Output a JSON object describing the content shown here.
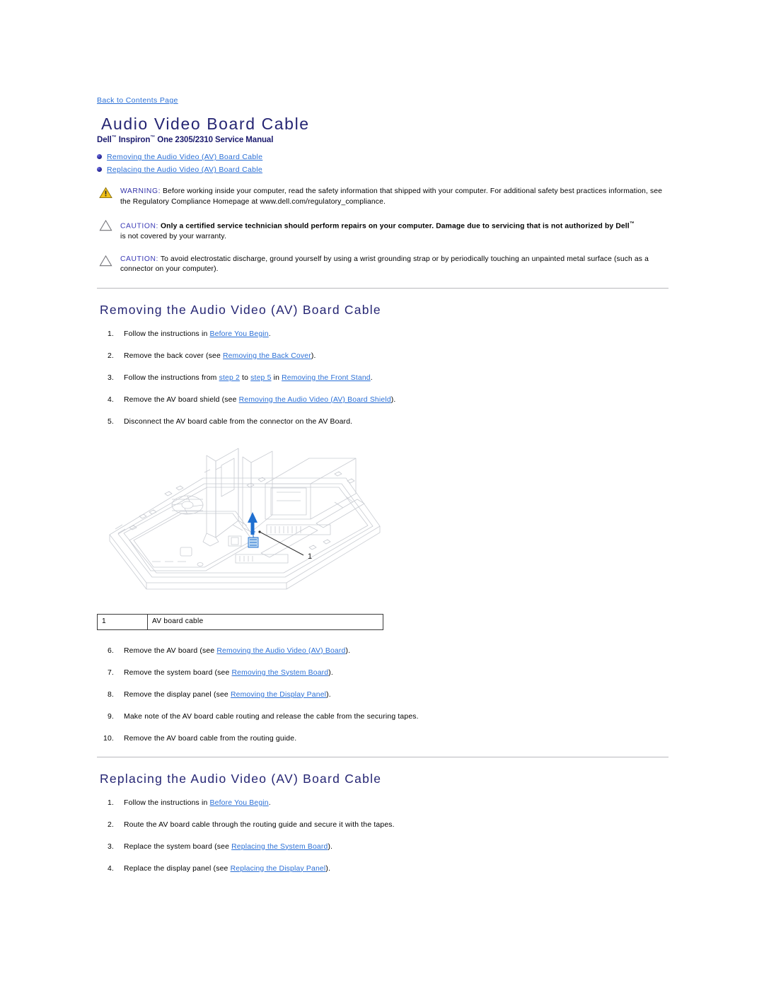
{
  "back_link": "Back to Contents Page",
  "title": "Audio Video Board Cable",
  "subtitle_parts": {
    "dell": "Dell",
    "tm1": "™",
    "inspiron": " Inspiron",
    "tm2": "™",
    "rest": " One 2305/2310 Service Manual"
  },
  "toc": [
    {
      "label": "Removing the Audio Video (AV) Board Cable"
    },
    {
      "label": "Replacing the Audio Video (AV) Board Cable"
    }
  ],
  "notices": [
    {
      "icon": "warning-triangle-icon",
      "keyword": "WARNING:",
      "body": " Before working inside your computer, read the safety information that shipped with your computer. For additional safety best practices information, see the Regulatory Compliance Homepage at www.dell.com/regulatory_compliance.",
      "bold": false
    },
    {
      "icon": "caution-triangle-icon",
      "keyword": "CAUTION:",
      "bold_body": " Only a certified service technician should perform repairs on your computer. Damage due to servicing that is not authorized by Dell",
      "tm": "™",
      "tail": "is not covered by your warranty.",
      "bold": true
    },
    {
      "icon": "caution-triangle-icon",
      "keyword": "CAUTION:",
      "body": " To avoid electrostatic discharge, ground yourself by using a wrist grounding strap or by periodically touching an unpainted metal surface (such as a connector on your computer).",
      "bold": false
    }
  ],
  "removing": {
    "heading": "Removing the Audio Video (AV) Board Cable",
    "steps_before_figure": [
      {
        "num": "1.",
        "pre": "Follow the instructions in ",
        "link": "Before You Begin",
        "post": "."
      },
      {
        "num": "2.",
        "pre": "Remove the back cover (see ",
        "link": "Removing the Back Cover",
        "post": ")."
      },
      {
        "num": "3.",
        "pre": "Follow the instructions from ",
        "link": "step 2",
        "mid1": " to ",
        "link2": "step 5",
        "mid2": " in ",
        "link3": "Removing the Front Stand",
        "post": "."
      },
      {
        "num": "4.",
        "pre": "Remove the AV board shield (see ",
        "link": "Removing the Audio Video (AV) Board Shield",
        "post": ")."
      },
      {
        "num": "5.",
        "pre": "Disconnect the AV board cable from the connector on the AV Board.",
        "link": "",
        "post": ""
      }
    ],
    "steps_after_figure": [
      {
        "num": "6.",
        "pre": "Remove the AV board (see ",
        "link": "Removing the Audio Video (AV) Board",
        "post": ")."
      },
      {
        "num": "7.",
        "pre": "Remove the system board (see ",
        "link": "Removing the System Board",
        "post": ")."
      },
      {
        "num": "8.",
        "pre": "Remove the display panel (see ",
        "link": "Removing the Display Panel",
        "post": ")."
      },
      {
        "num": "9.",
        "pre": "Make note of the AV board cable routing and release the cable from the securing tapes.",
        "link": "",
        "post": ""
      },
      {
        "num": "10.",
        "pre": "Remove the AV board cable from the routing guide.",
        "link": "",
        "post": ""
      }
    ]
  },
  "figure": {
    "callout_number": "1",
    "alt": "Exploded view of the computer chassis showing the AV board cable being disconnected",
    "arrow_color": "#1f6fd0",
    "line_color": "#c9ccd2"
  },
  "legend": {
    "rows": [
      {
        "index": "1",
        "label": "AV board cable"
      }
    ]
  },
  "replacing": {
    "heading": "Replacing the Audio Video (AV) Board Cable",
    "steps": [
      {
        "num": "1.",
        "pre": "Follow the instructions in ",
        "link": "Before You Begin",
        "post": "."
      },
      {
        "num": "2.",
        "pre": "Route the AV board cable through the routing guide and secure it with the tapes.",
        "link": "",
        "post": ""
      },
      {
        "num": "3.",
        "pre": "Replace the system board (see ",
        "link": "Replacing the System Board",
        "post": ")."
      },
      {
        "num": "4.",
        "pre": "Replace the display panel (see ",
        "link": "Replacing the Display Panel",
        "post": ")."
      }
    ]
  },
  "colors": {
    "title_navy": "#252573",
    "link_blue": "#2a6fd6",
    "warning_yellow": "#f2c117",
    "rule_gray": "#b9b9bd"
  }
}
